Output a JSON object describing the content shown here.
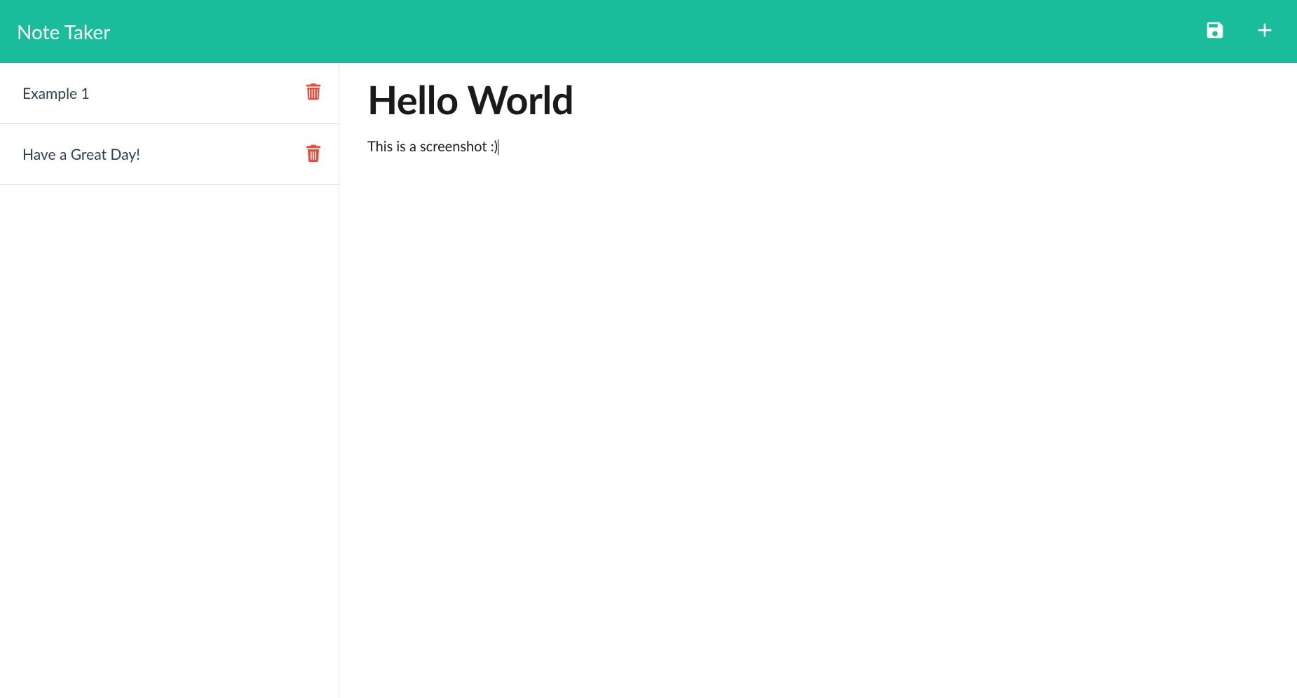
{
  "header": {
    "title": "Note Taker"
  },
  "sidebar": {
    "notes": [
      {
        "title": "Example 1"
      },
      {
        "title": "Have a Great Day!"
      }
    ]
  },
  "editor": {
    "title": "Hello World",
    "body": "This is a screenshot :)"
  }
}
